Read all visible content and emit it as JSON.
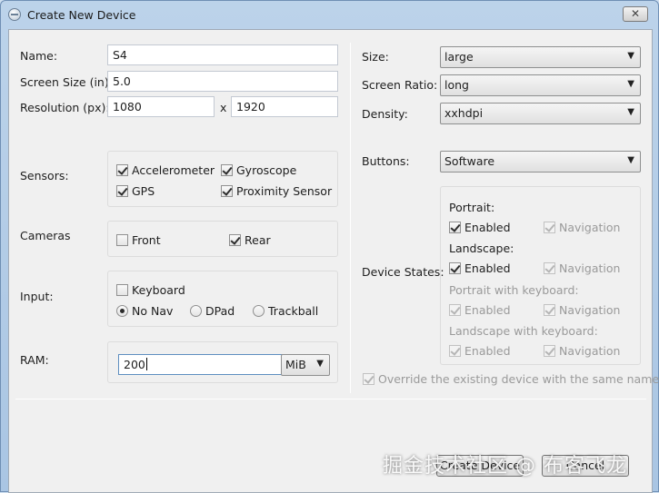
{
  "window": {
    "title": "Create New Device",
    "close_glyph": "✕"
  },
  "left": {
    "name_label": "Name:",
    "name_value": "S4",
    "screen_size_label": "Screen Size (in):",
    "screen_size_value": "5.0",
    "resolution_label": "Resolution (px):",
    "res_width": "1080",
    "res_sep": "x",
    "res_height": "1920",
    "sensors_label": "Sensors:",
    "sensors": [
      {
        "label": "Accelerometer",
        "checked": true
      },
      {
        "label": "Gyroscope",
        "checked": true
      },
      {
        "label": "GPS",
        "checked": true
      },
      {
        "label": "Proximity Sensor",
        "checked": true
      }
    ],
    "cameras_label": "Cameras",
    "cameras": [
      {
        "label": "Front",
        "checked": false
      },
      {
        "label": "Rear",
        "checked": true
      }
    ],
    "input_label": "Input:",
    "keyboard": {
      "label": "Keyboard",
      "checked": false
    },
    "nav_options": [
      {
        "label": "No Nav",
        "selected": true
      },
      {
        "label": "DPad",
        "selected": false
      },
      {
        "label": "Trackball",
        "selected": false
      }
    ],
    "ram_label": "RAM:",
    "ram_value": "200",
    "ram_unit": "MiB"
  },
  "right": {
    "size_label": "Size:",
    "size_value": "large",
    "ratio_label": "Screen Ratio:",
    "ratio_value": "long",
    "density_label": "Density:",
    "density_value": "xxhdpi",
    "buttons_label": "Buttons:",
    "buttons_value": "Software",
    "device_states_label": "Device States:",
    "portrait_label": "Portrait:",
    "landscape_label": "Landscape:",
    "portrait_kb_label": "Portrait with keyboard:",
    "landscape_kb_label": "Landscape with keyboard:",
    "enabled_label": "Enabled",
    "navigation_label": "Navigation",
    "override_label": "Override the existing device with the same name"
  },
  "footer": {
    "create_label": "Create Device",
    "cancel_label": "Cancel"
  },
  "watermark": "掘金技术社区 @ 布客飞龙"
}
